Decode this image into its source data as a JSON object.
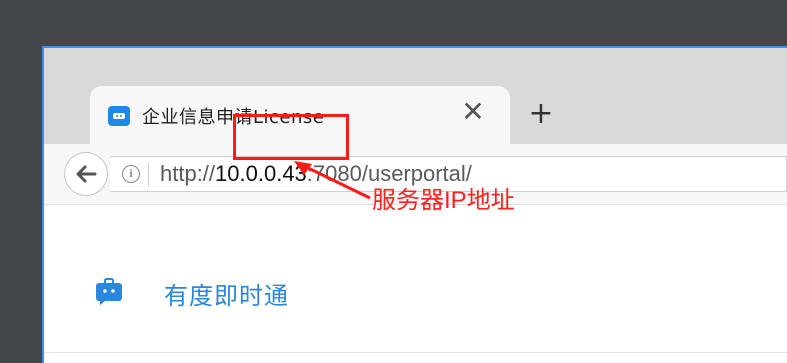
{
  "browser": {
    "tab": {
      "title": "企业信息申请License",
      "favicon": "chat-bot-icon",
      "close_icon": "close-icon"
    },
    "new_tab_icon": "plus-icon",
    "nav": {
      "back_icon": "back-arrow-icon",
      "info_icon": "info-icon"
    },
    "url": {
      "scheme": "http://",
      "host": "10.0.0.43",
      "rest": ":7080/userportal/"
    }
  },
  "annotation": {
    "label": "服务器IP地址",
    "color": "#ff1a1a"
  },
  "page": {
    "brand": "有度即时通",
    "logo_icon": "briefcase-chat-icon",
    "accent": "#2a86de"
  }
}
